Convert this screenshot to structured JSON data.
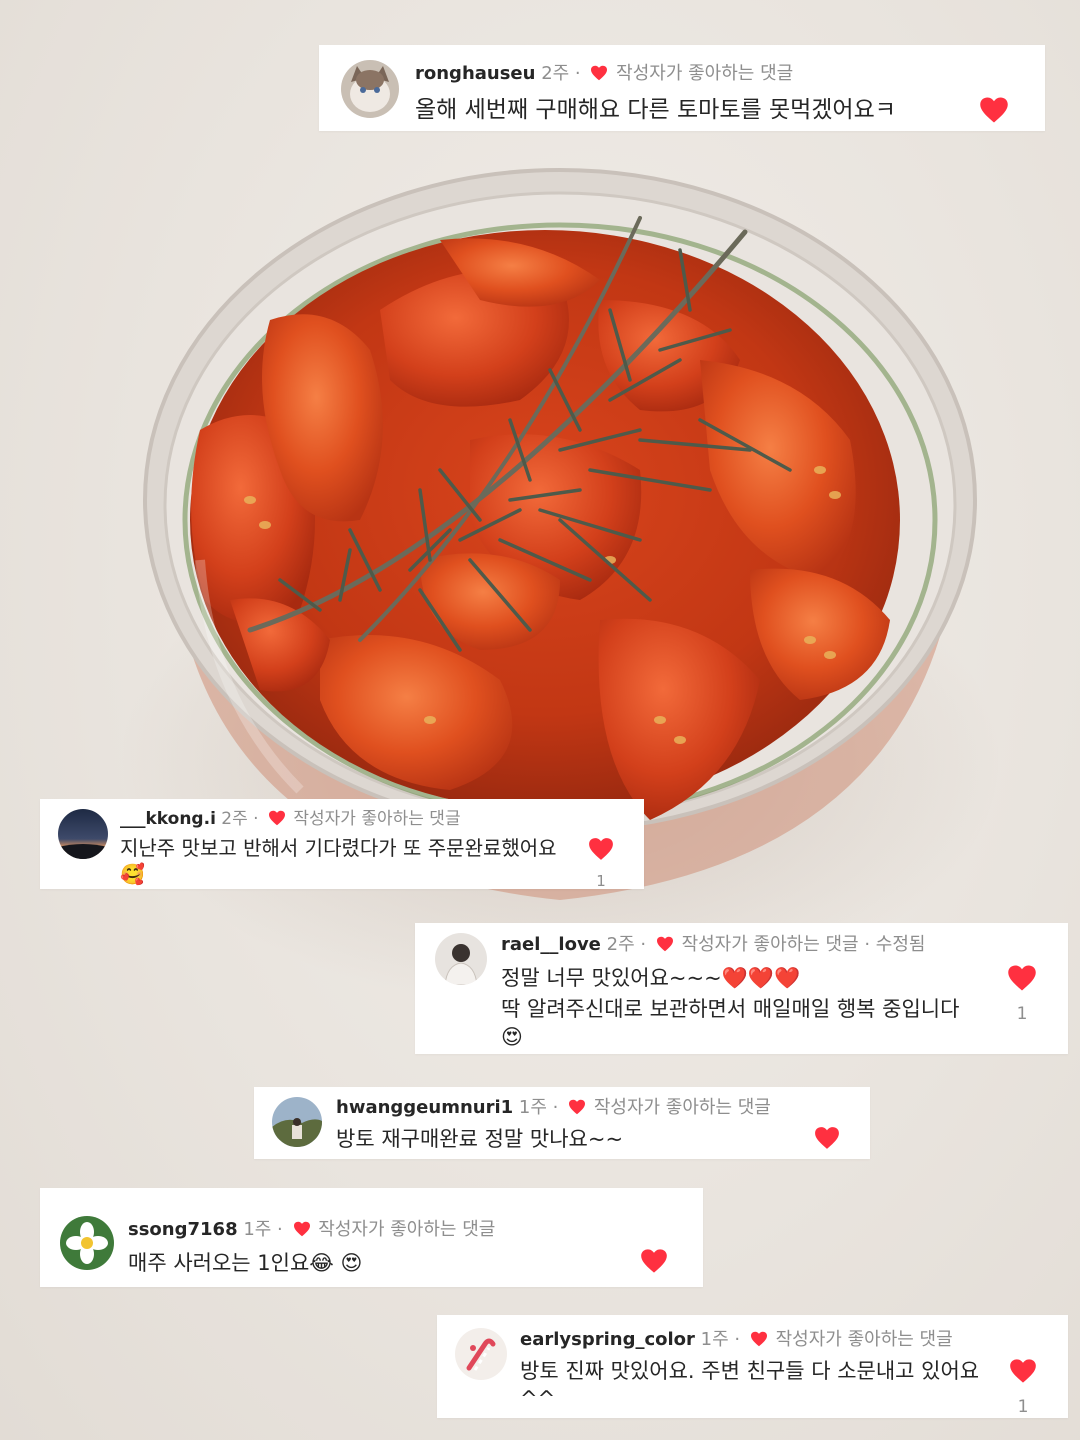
{
  "comments": [
    {
      "username": "ronghauseu",
      "time": "2주 ·",
      "liked_label": "작성자가 좋아하는 댓글",
      "edited": "",
      "text": "올해 세번째 구매해요 다른 토마토를 못먹겠어요ㅋ",
      "likes": "",
      "avatar": "cat-photo"
    },
    {
      "username": "___kkong.i",
      "time": "2주 ·",
      "liked_label": "작성자가 좋아하는 댓글",
      "edited": "",
      "text": "지난주 맛보고 반해서 기다렸다가 또 주문완료했어요🥰",
      "likes": "1",
      "avatar": "sunset-photo"
    },
    {
      "username": "rael__love",
      "time": "2주 ·",
      "liked_label": "작성자가 좋아하는 댓글",
      "edited": "· 수정됨",
      "text": "정말 너무 맛있어요~~~❤️❤️❤️",
      "text2": "딱 알려주신대로 보관하면서 매일매일 행복 중입니다 😍",
      "likes": "1",
      "avatar": "person-photo"
    },
    {
      "username": "hwanggeumnuri1",
      "time": "1주 ·",
      "liked_label": "작성자가 좋아하는 댓글",
      "edited": "",
      "text": "방토 재구매완료 정말 맛나요~~",
      "likes": "",
      "avatar": "landscape-photo"
    },
    {
      "username": "ssong7168",
      "time": "1주 ·",
      "liked_label": "작성자가 좋아하는 댓글",
      "edited": "",
      "text": "매주 사러오는 1인요😂 😍",
      "likes": "",
      "avatar": "flower-photo"
    },
    {
      "username": "earlyspring_color",
      "time": "1주 ·",
      "liked_label": "작성자가 좋아하는 댓글",
      "edited": "",
      "text": "방토 진짜 맛있어요. 주변 친구들 다 소문내고 있어요^^",
      "likes": "1",
      "avatar": "candy-cane-photo"
    }
  ],
  "colors": {
    "heart": "#ff3040",
    "meta_text": "#8e8e8e",
    "body_text": "#262626"
  }
}
